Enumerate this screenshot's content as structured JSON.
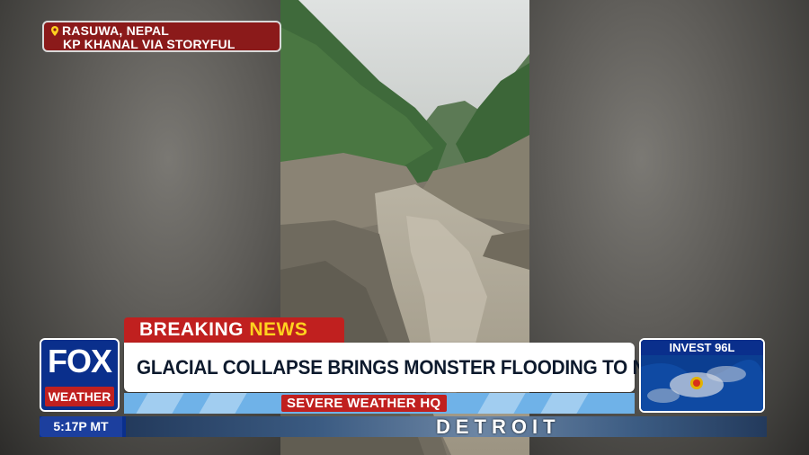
{
  "location_tag": {
    "line1": "RASUWA, NEPAL",
    "line2": "KP KHANAL VIA STORYFUL"
  },
  "breaking": {
    "word1": "BREAKING",
    "word2": "NEWS"
  },
  "logo": {
    "top": "FOX",
    "bottom": "WEATHER"
  },
  "headline": "GLACIAL COLLAPSE BRINGS MONSTER FLOODING TO NEPAL",
  "severe_bar": {
    "label": "SEVERE WEATHER HQ"
  },
  "invest_box": {
    "label": "INVEST 96L"
  },
  "ticker": {
    "time": "5:17P MT",
    "city": "DETROIT"
  },
  "colors": {
    "brand_blue": "#0a2f8c",
    "breaking_red": "#c0201f",
    "news_yellow": "#ffd21f"
  }
}
